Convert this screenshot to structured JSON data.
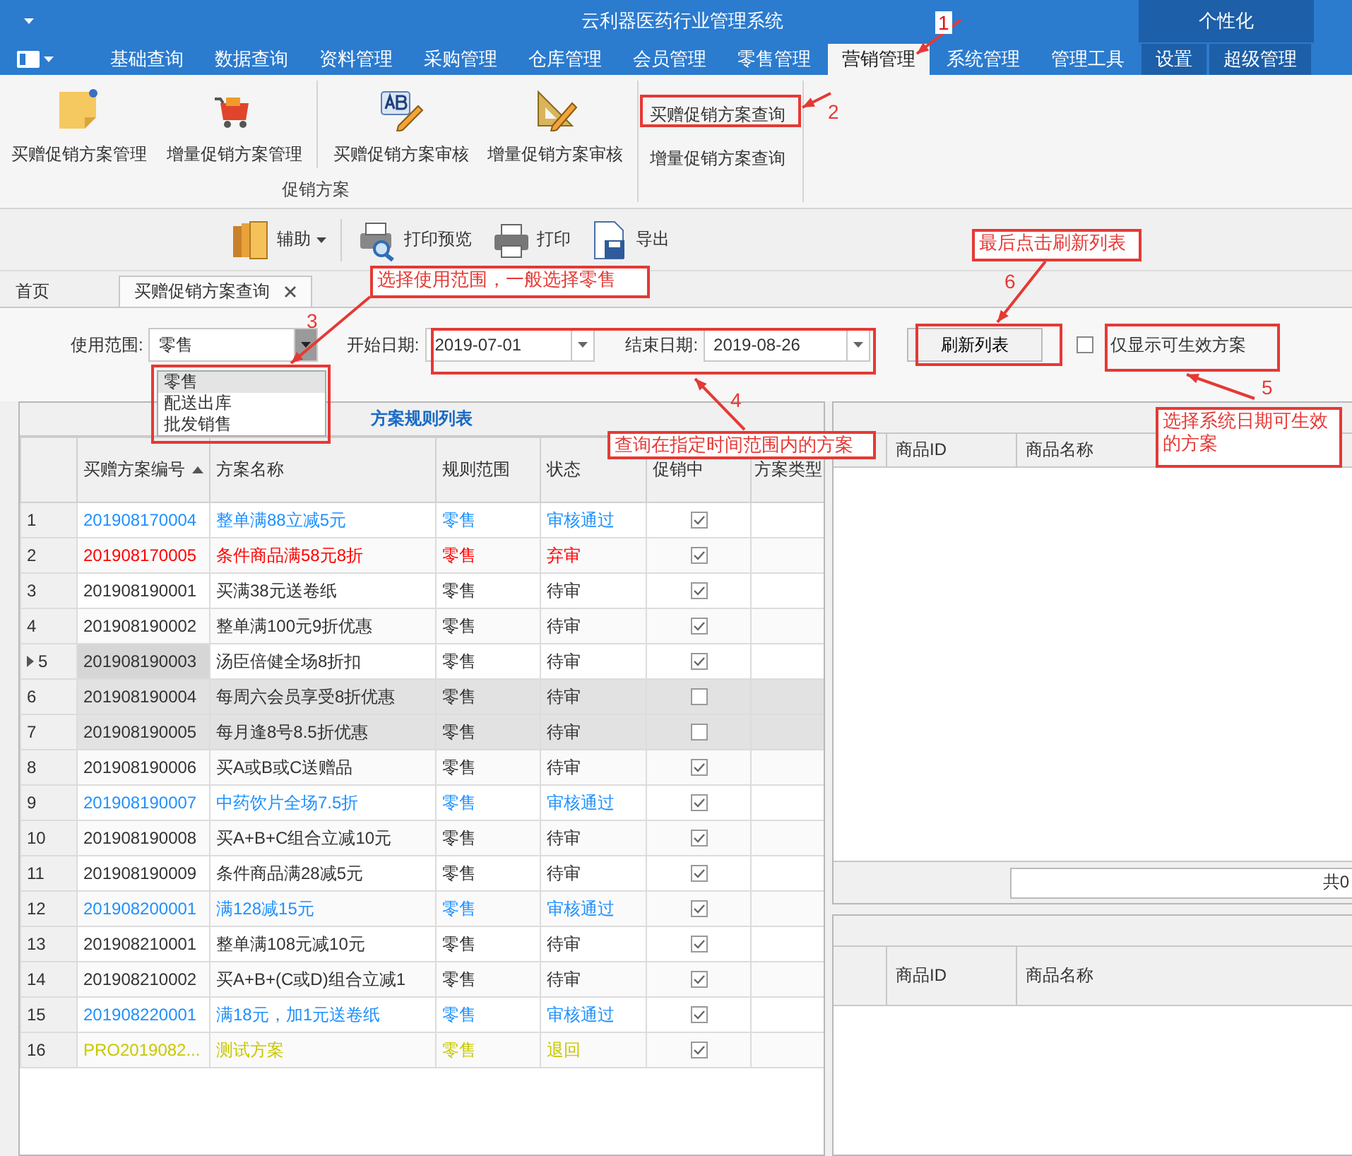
{
  "window": {
    "title": "云利器医药行业管理系统",
    "personalize": "个性化"
  },
  "menu_tabs": [
    {
      "label": "基础查询",
      "selected": false
    },
    {
      "label": "数据查询",
      "selected": false
    },
    {
      "label": "资料管理",
      "selected": false
    },
    {
      "label": "采购管理",
      "selected": false
    },
    {
      "label": "仓库管理",
      "selected": false
    },
    {
      "label": "会员管理",
      "selected": false
    },
    {
      "label": "零售管理",
      "selected": false
    },
    {
      "label": "营销管理",
      "selected": true
    },
    {
      "label": "系统管理",
      "selected": false
    },
    {
      "label": "管理工具",
      "selected": false
    },
    {
      "label": "设置",
      "selected": false
    },
    {
      "label": "超级管理",
      "selected": false
    }
  ],
  "ribbon": {
    "group_label": "促销方案",
    "large_items": [
      {
        "label": "买赠促销方案管理",
        "kind": "note"
      },
      {
        "label": "增量促销方案管理",
        "kind": "cart"
      },
      {
        "label": "买赠促销方案审核",
        "kind": "ab-pen"
      },
      {
        "label": "增量促销方案审核",
        "kind": "ruler-pen"
      }
    ],
    "small_items": [
      {
        "label": "买赠促销方案查询"
      },
      {
        "label": "增量促销方案查询"
      }
    ]
  },
  "toolbar": [
    {
      "label": "辅助",
      "kind": "books",
      "has_menu": true
    },
    {
      "label": "打印预览",
      "kind": "preview",
      "has_menu": false
    },
    {
      "label": "打印",
      "kind": "printer",
      "has_menu": false
    },
    {
      "label": "导出",
      "kind": "export",
      "has_menu": false
    }
  ],
  "doc_tabs": [
    {
      "label": "首页",
      "selected": false,
      "closable": false
    },
    {
      "label": "买赠促销方案查询",
      "selected": true,
      "closable": true
    }
  ],
  "filters": {
    "scope": {
      "label": "使用范围:",
      "value": "零售",
      "expanded": true,
      "options": [
        {
          "label": "零售",
          "selected": true
        },
        {
          "label": "配送出库",
          "selected": false
        },
        {
          "label": "批发销售",
          "selected": false
        }
      ]
    },
    "start": {
      "label": "开始日期:",
      "value": "2019-07-01"
    },
    "end": {
      "label": "结束日期:",
      "value": "2019-08-26"
    },
    "refresh": "刷新列表",
    "effective_only": {
      "label": "仅显示可生效方案",
      "checked": false
    }
  },
  "rules_table": {
    "title": "方案规则列表",
    "columns": [
      {
        "label": "买赠方案编号",
        "sorted_ascending": true
      },
      {
        "label": "方案名称",
        "sorted_ascending": false
      },
      {
        "label": "规则范围",
        "sorted_ascending": false
      },
      {
        "label": "状态",
        "sorted_ascending": false
      },
      {
        "label": "促销中",
        "sorted_ascending": false
      },
      {
        "label": "方案类型",
        "sorted_ascending": false
      }
    ],
    "rows": [
      {
        "no": "1",
        "id": "201908170004",
        "name": "整单满88立减5元",
        "scope": "零售",
        "status": "审核通过",
        "promoting": true,
        "color": "#1e90ff",
        "selected": false,
        "current": false
      },
      {
        "no": "2",
        "id": "201908170005",
        "name": "条件商品满58元8折",
        "scope": "零售",
        "status": "弃审",
        "promoting": true,
        "color": "#ff0000",
        "selected": false,
        "current": false
      },
      {
        "no": "3",
        "id": "201908190001",
        "name": "买满38元送卷纸",
        "scope": "零售",
        "status": "待审",
        "promoting": true,
        "color": "#333333",
        "selected": false,
        "current": false
      },
      {
        "no": "4",
        "id": "201908190002",
        "name": "整单满100元9折优惠",
        "scope": "零售",
        "status": "待审",
        "promoting": true,
        "color": "#333333",
        "selected": false,
        "current": false
      },
      {
        "no": "5",
        "id": "201908190003",
        "name": "汤臣倍健全场8折扣",
        "scope": "零售",
        "status": "待审",
        "promoting": true,
        "color": "#333333",
        "selected": false,
        "current": true
      },
      {
        "no": "6",
        "id": "201908190004",
        "name": "每周六会员享受8折优惠",
        "scope": "零售",
        "status": "待审",
        "promoting": false,
        "color": "#333333",
        "selected": true,
        "current": false
      },
      {
        "no": "7",
        "id": "201908190005",
        "name": "每月逢8号8.5折优惠",
        "scope": "零售",
        "status": "待审",
        "promoting": false,
        "color": "#333333",
        "selected": true,
        "current": false
      },
      {
        "no": "8",
        "id": "201908190006",
        "name": "买A或B或C送赠品",
        "scope": "零售",
        "status": "待审",
        "promoting": true,
        "color": "#333333",
        "selected": false,
        "current": false
      },
      {
        "no": "9",
        "id": "201908190007",
        "name": "中药饮片全场7.5折",
        "scope": "零售",
        "status": "审核通过",
        "promoting": true,
        "color": "#1e90ff",
        "selected": false,
        "current": false
      },
      {
        "no": "10",
        "id": "201908190008",
        "name": "买A+B+C组合立减10元",
        "scope": "零售",
        "status": "待审",
        "promoting": true,
        "color": "#333333",
        "selected": false,
        "current": false
      },
      {
        "no": "11",
        "id": "201908190009",
        "name": "条件商品满28减5元",
        "scope": "零售",
        "status": "待审",
        "promoting": true,
        "color": "#333333",
        "selected": false,
        "current": false
      },
      {
        "no": "12",
        "id": "201908200001",
        "name": "满128减15元",
        "scope": "零售",
        "status": "审核通过",
        "promoting": true,
        "color": "#1e90ff",
        "selected": false,
        "current": false
      },
      {
        "no": "13",
        "id": "201908210001",
        "name": "整单满108元减10元",
        "scope": "零售",
        "status": "待审",
        "promoting": true,
        "color": "#333333",
        "selected": false,
        "current": false
      },
      {
        "no": "14",
        "id": "201908210002",
        "name": "买A+B+(C或D)组合立减1",
        "scope": "零售",
        "status": "待审",
        "promoting": true,
        "color": "#333333",
        "selected": false,
        "current": false
      },
      {
        "no": "15",
        "id": "201908220001",
        "name": "满18元，加1元送卷纸",
        "scope": "零售",
        "status": "审核通过",
        "promoting": true,
        "color": "#1e90ff",
        "selected": false,
        "current": false
      },
      {
        "no": "16",
        "id": "PRO2019082...",
        "name": "测试方案",
        "scope": "零售",
        "status": "退回",
        "promoting": true,
        "color": "#c8c800",
        "selected": false,
        "current": false
      }
    ]
  },
  "items_table": {
    "columns": [
      "商品ID",
      "商品名称"
    ],
    "footer": "共0"
  },
  "detail_table": {
    "columns": [
      "商品ID",
      "商品名称"
    ]
  },
  "annotations": [
    {
      "kind": "number",
      "text": "1"
    },
    {
      "kind": "number",
      "text": "2"
    },
    {
      "kind": "callout",
      "text": "选择使用范围，一般选择零售"
    },
    {
      "kind": "number",
      "text": "3"
    },
    {
      "kind": "callout",
      "text": "最后点击刷新列表"
    },
    {
      "kind": "number",
      "text": "6"
    },
    {
      "kind": "number",
      "text": "4"
    },
    {
      "kind": "callout",
      "text": "查询在指定时间范围内的方案"
    },
    {
      "kind": "number",
      "text": "5"
    },
    {
      "kind": "callout",
      "text": "选择系统日期可生效的方案"
    }
  ]
}
